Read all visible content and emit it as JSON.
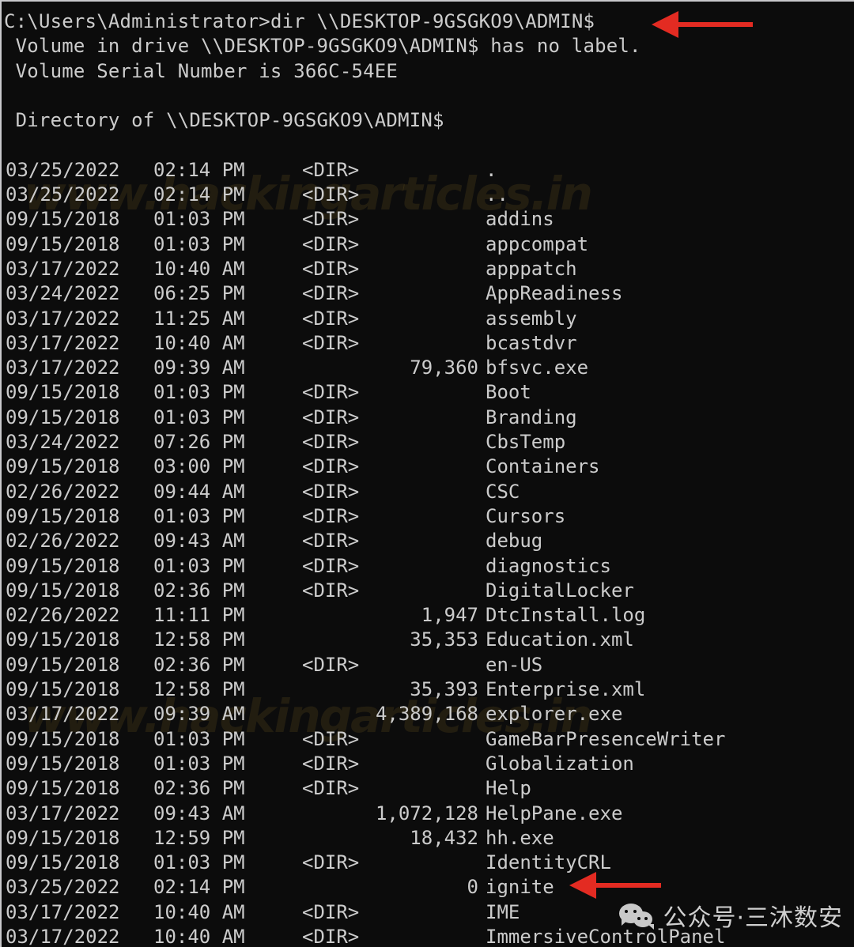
{
  "window": {
    "app_title": "Command Prompt",
    "background_color": "#0c0c0c",
    "text_color": "#cccccc",
    "annotation_color": "#e32b22"
  },
  "header": {
    "prompt": "C:\\Users\\Administrator>",
    "command": "dir \\\\DESKTOP-9GSGKO9\\ADMIN$",
    "volume_label_line": " Volume in drive \\\\DESKTOP-9GSGKO9\\ADMIN$ has no label.",
    "volume_serial_line": " Volume Serial Number is 366C-54EE",
    "blank_line": "",
    "directory_of_line": " Directory of \\\\DESKTOP-9GSGKO9\\ADMIN$",
    "blank_line2": ""
  },
  "listing": {
    "dir_marker": "<DIR>",
    "rows": [
      {
        "date": "03/25/2022",
        "time": "02:14 PM",
        "type": "dir",
        "size": "",
        "name": "."
      },
      {
        "date": "03/25/2022",
        "time": "02:14 PM",
        "type": "dir",
        "size": "",
        "name": ".."
      },
      {
        "date": "09/15/2018",
        "time": "01:03 PM",
        "type": "dir",
        "size": "",
        "name": "addins"
      },
      {
        "date": "09/15/2018",
        "time": "01:03 PM",
        "type": "dir",
        "size": "",
        "name": "appcompat"
      },
      {
        "date": "03/17/2022",
        "time": "10:40 AM",
        "type": "dir",
        "size": "",
        "name": "apppatch"
      },
      {
        "date": "03/24/2022",
        "time": "06:25 PM",
        "type": "dir",
        "size": "",
        "name": "AppReadiness"
      },
      {
        "date": "03/17/2022",
        "time": "11:25 AM",
        "type": "dir",
        "size": "",
        "name": "assembly"
      },
      {
        "date": "03/17/2022",
        "time": "10:40 AM",
        "type": "dir",
        "size": "",
        "name": "bcastdvr"
      },
      {
        "date": "03/17/2022",
        "time": "09:39 AM",
        "type": "file",
        "size": "79,360",
        "name": "bfsvc.exe"
      },
      {
        "date": "09/15/2018",
        "time": "01:03 PM",
        "type": "dir",
        "size": "",
        "name": "Boot"
      },
      {
        "date": "09/15/2018",
        "time": "01:03 PM",
        "type": "dir",
        "size": "",
        "name": "Branding"
      },
      {
        "date": "03/24/2022",
        "time": "07:26 PM",
        "type": "dir",
        "size": "",
        "name": "CbsTemp"
      },
      {
        "date": "09/15/2018",
        "time": "03:00 PM",
        "type": "dir",
        "size": "",
        "name": "Containers"
      },
      {
        "date": "02/26/2022",
        "time": "09:44 AM",
        "type": "dir",
        "size": "",
        "name": "CSC"
      },
      {
        "date": "09/15/2018",
        "time": "01:03 PM",
        "type": "dir",
        "size": "",
        "name": "Cursors"
      },
      {
        "date": "02/26/2022",
        "time": "09:43 AM",
        "type": "dir",
        "size": "",
        "name": "debug"
      },
      {
        "date": "09/15/2018",
        "time": "01:03 PM",
        "type": "dir",
        "size": "",
        "name": "diagnostics"
      },
      {
        "date": "09/15/2018",
        "time": "02:36 PM",
        "type": "dir",
        "size": "",
        "name": "DigitalLocker"
      },
      {
        "date": "02/26/2022",
        "time": "11:11 PM",
        "type": "file",
        "size": "1,947",
        "name": "DtcInstall.log"
      },
      {
        "date": "09/15/2018",
        "time": "12:58 PM",
        "type": "file",
        "size": "35,353",
        "name": "Education.xml"
      },
      {
        "date": "09/15/2018",
        "time": "02:36 PM",
        "type": "dir",
        "size": "",
        "name": "en-US"
      },
      {
        "date": "09/15/2018",
        "time": "12:58 PM",
        "type": "file",
        "size": "35,393",
        "name": "Enterprise.xml"
      },
      {
        "date": "03/17/2022",
        "time": "09:39 AM",
        "type": "file",
        "size": "4,389,168",
        "name": "explorer.exe"
      },
      {
        "date": "09/15/2018",
        "time": "01:03 PM",
        "type": "dir",
        "size": "",
        "name": "GameBarPresenceWriter"
      },
      {
        "date": "09/15/2018",
        "time": "01:03 PM",
        "type": "dir",
        "size": "",
        "name": "Globalization"
      },
      {
        "date": "09/15/2018",
        "time": "02:36 PM",
        "type": "dir",
        "size": "",
        "name": "Help"
      },
      {
        "date": "03/17/2022",
        "time": "09:43 AM",
        "type": "file",
        "size": "1,072,128",
        "name": "HelpPane.exe"
      },
      {
        "date": "09/15/2018",
        "time": "12:59 PM",
        "type": "file",
        "size": "18,432",
        "name": "hh.exe"
      },
      {
        "date": "09/15/2018",
        "time": "01:03 PM",
        "type": "dir",
        "size": "",
        "name": "IdentityCRL"
      },
      {
        "date": "03/25/2022",
        "time": "02:14 PM",
        "type": "file",
        "size": "0",
        "name": "ignite"
      },
      {
        "date": "03/17/2022",
        "time": "10:40 AM",
        "type": "dir",
        "size": "",
        "name": "IME"
      },
      {
        "date": "03/17/2022",
        "time": "10:40 AM",
        "type": "dir",
        "size": "",
        "name": "ImmersiveControlPanel"
      }
    ]
  },
  "annotations": {
    "arrow_command": {
      "points_to": "dir \\\\DESKTOP-9GSGKO9\\ADMIN$",
      "color": "#e32b22"
    },
    "arrow_ignite": {
      "points_to": "ignite",
      "color": "#e32b22"
    }
  },
  "watermarks": {
    "site": "www.hackingarticles.in",
    "wechat_text": "公众号·三沐数安"
  }
}
